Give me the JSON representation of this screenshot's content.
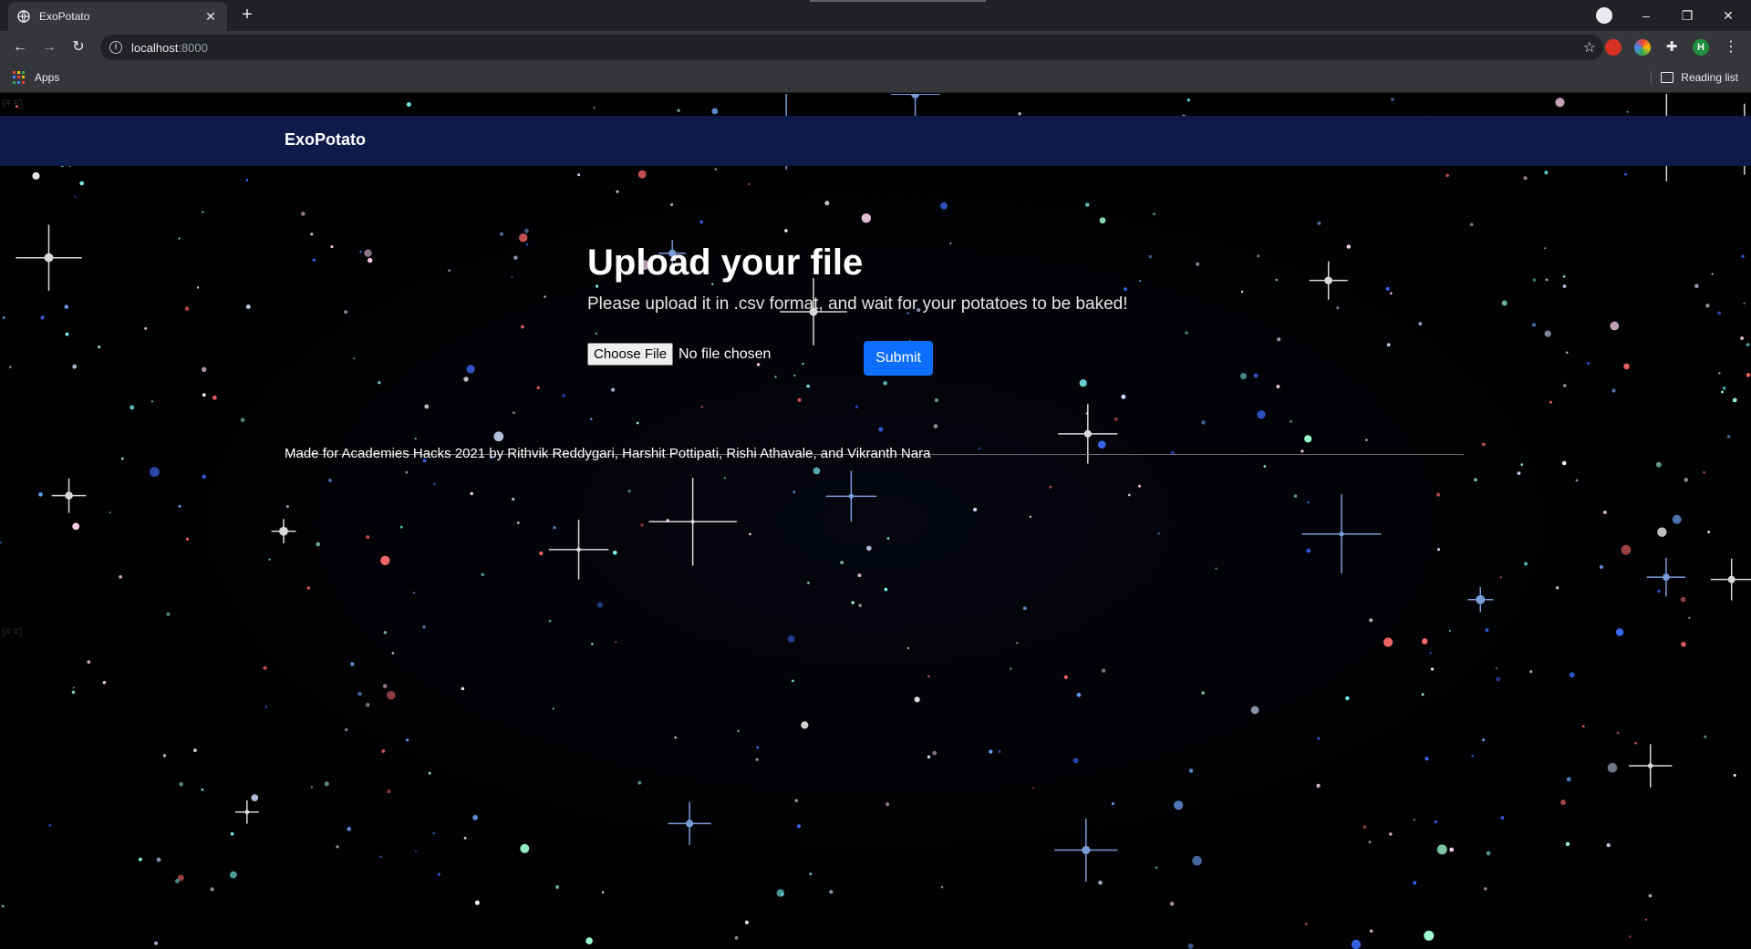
{
  "browser": {
    "tab_title": "ExoPotato",
    "tab_close": "✕",
    "new_tab": "+",
    "url_host": "localhost",
    "url_port": ":8000",
    "bookmarks": {
      "apps_label": "Apps",
      "reading_list_label": "Reading list"
    },
    "profile_initial": "H",
    "window_controls": {
      "minimize": "–",
      "restore": "❐",
      "close": "✕"
    },
    "nav": {
      "back": "←",
      "forward": "→",
      "reload": "↻",
      "menu": "⋮"
    },
    "icons": [
      "globe-icon",
      "close-icon",
      "plus-icon",
      "back-icon",
      "forward-icon",
      "reload-icon",
      "info-icon",
      "star-icon",
      "extension-icon",
      "puzzle-icon",
      "kebab-menu-icon",
      "apps-grid-icon",
      "reading-list-icon"
    ]
  },
  "page": {
    "brand": "ExoPotato",
    "template_tag": "{# #}",
    "heading": "Upload your file",
    "subtitle": "Please upload it in .csv format, and wait for your potatoes to be baked!",
    "choose_file_label": "Choose File",
    "no_file_text": "No file chosen",
    "submit_label": "Submit",
    "credits": "Made for Academies Hacks 2021 by Rithvik Reddygari, Harshit Pottipati, Rishi Athavale, and Vikranth Nara"
  },
  "colors": {
    "navbar": "#0d1a4a",
    "submit": "#0d6efd",
    "background": "#000000",
    "profile": "#1e8e3e"
  }
}
